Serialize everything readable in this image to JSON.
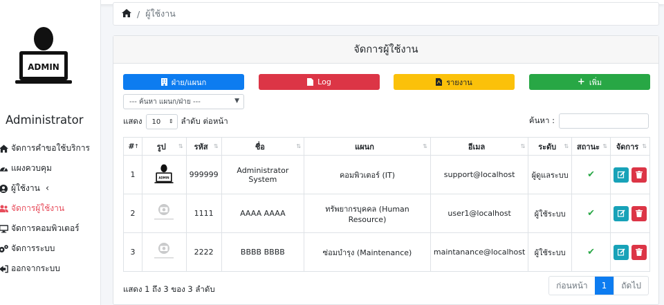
{
  "sidebar": {
    "avatar_label": "ADMIN",
    "user_name": "Administrator",
    "items": [
      {
        "label": "จัดการคำขอใช้บริการ",
        "icon": "home-icon"
      },
      {
        "label": "แผงควบคุม",
        "icon": "dashboard-icon"
      },
      {
        "label": "ผู้ใช้งาน",
        "icon": "user-circle-icon"
      },
      {
        "label": "จัดการผู้ใช้งาน",
        "icon": "users-icon"
      },
      {
        "label": "จัดการคอมพิวเตอร์",
        "icon": "desktop-icon"
      },
      {
        "label": "จัดการระบบ",
        "icon": "cogs-icon"
      },
      {
        "label": "ออกจากระบบ",
        "icon": "sign-out-icon"
      }
    ]
  },
  "breadcrumb": {
    "sep": "/",
    "current": "ผู้ใช้งาน"
  },
  "card": {
    "title": "จัดการผู้ใช้งาน"
  },
  "buttons": {
    "dept": "ฝ่าย/แผนก",
    "log": "Log",
    "report": "รายงาน",
    "add": "เพิ่ม"
  },
  "filter": {
    "placeholder": "--- ค้นหา แผนก/ฝ่าย ---"
  },
  "length": {
    "prefix": "แสดง",
    "value": "10",
    "suffix": "ลำดับ ต่อหน้า"
  },
  "search": {
    "label": "ค้นหา :"
  },
  "table": {
    "headers": [
      "#",
      "รูป",
      "รหัส",
      "ชื่อ",
      "แผนก",
      "อีเมล",
      "ระดับ",
      "สถานะ",
      "จัดการ"
    ],
    "rows": [
      {
        "no": "1",
        "photo": "admin",
        "code": "999999",
        "name": "Administrator System",
        "dept": "คอมพิวเตอร์ (IT)",
        "email": "support@localhost",
        "level": "ผู้ดูแลระบบ"
      },
      {
        "no": "2",
        "photo": "noimage",
        "code": "1111",
        "name": "AAAA AAAA",
        "dept": "ทรัพยากรบุคคล (Human Resource)",
        "email": "user1@localhost",
        "level": "ผู้ใช้ระบบ"
      },
      {
        "no": "3",
        "photo": "noimage",
        "code": "2222",
        "name": "BBBB BBBB",
        "dept": "ซ่อมบำรุง (Maintenance)",
        "email": "maintanance@localhost",
        "level": "ผู้ใช้ระบบ"
      }
    ]
  },
  "info": "แสดง 1 ถึง 3 ของ 3 ลำดับ",
  "pager": {
    "prev": "ก่อนหน้า",
    "current": "1",
    "next": "ถัดไป"
  },
  "colors": {
    "primary": "#0d7cf0",
    "danger": "#dc3546",
    "warning": "#fbc10a",
    "success": "#28a745",
    "info": "#18a2b8",
    "active_nav": "#e74c5b"
  }
}
